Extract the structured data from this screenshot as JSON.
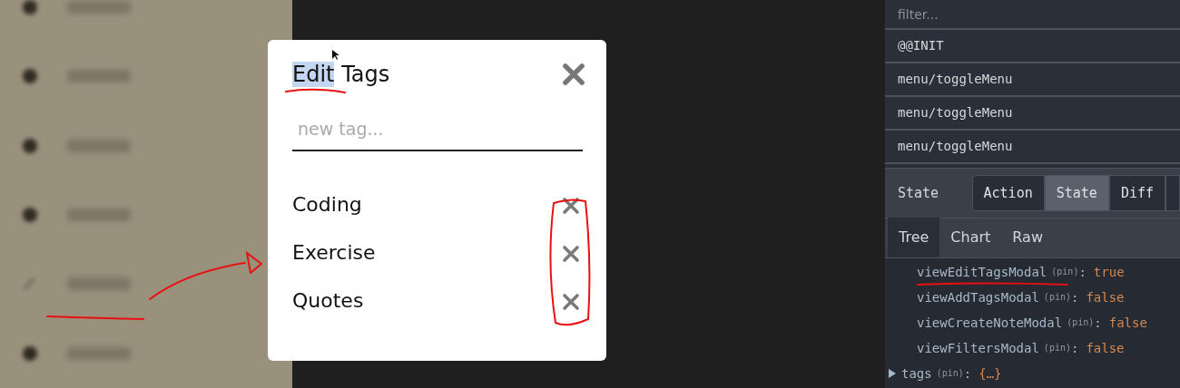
{
  "sidebar": {
    "items": [
      {
        "kind": "dot"
      },
      {
        "kind": "dot"
      },
      {
        "kind": "dot"
      },
      {
        "kind": "dot"
      },
      {
        "kind": "pencil"
      },
      {
        "kind": "dot"
      }
    ]
  },
  "modal": {
    "title": [
      {
        "text": "Edit",
        "highlighted": true
      },
      {
        "text": "Tags",
        "highlighted": false
      }
    ],
    "input": {
      "placeholder": "new tag..."
    },
    "tags": [
      {
        "label": "Coding"
      },
      {
        "label": "Exercise"
      },
      {
        "label": "Quotes"
      }
    ]
  },
  "devtools": {
    "filter": {
      "placeholder": "filter..."
    },
    "actions": [
      {
        "label": "@@INIT"
      },
      {
        "label": "menu/toggleMenu"
      },
      {
        "label": "menu/toggleMenu"
      },
      {
        "label": "menu/toggleMenu"
      }
    ],
    "section_label": "State",
    "buttons": [
      {
        "label": "Action",
        "selected": false
      },
      {
        "label": "State",
        "selected": true
      },
      {
        "label": "Diff",
        "selected": false
      }
    ],
    "tabs": [
      {
        "label": "Tree",
        "selected": true
      },
      {
        "label": "Chart",
        "selected": false
      },
      {
        "label": "Raw",
        "selected": false
      }
    ],
    "tree": [
      {
        "kind": "leaf",
        "key": "viewEditTagsModal",
        "pin": "(pin)",
        "separator": ":",
        "value": "true"
      },
      {
        "kind": "leaf",
        "key": "viewAddTagsModal",
        "pin": "(pin)",
        "separator": ":",
        "value": "false"
      },
      {
        "kind": "leaf",
        "key": "viewCreateNoteModal",
        "pin": "(pin)",
        "separator": ":",
        "value": "false"
      },
      {
        "kind": "leaf",
        "key": "viewFiltersModal",
        "pin": "(pin)",
        "separator": ":",
        "value": "false"
      },
      {
        "kind": "node",
        "key": "tags",
        "pin": "(pin)",
        "separator": ":",
        "value": "{…}"
      }
    ]
  },
  "annotations": [
    {
      "kind": "underline"
    },
    {
      "kind": "underline"
    },
    {
      "kind": "arrow"
    },
    {
      "kind": "loop"
    },
    {
      "kind": "underline"
    }
  ]
}
